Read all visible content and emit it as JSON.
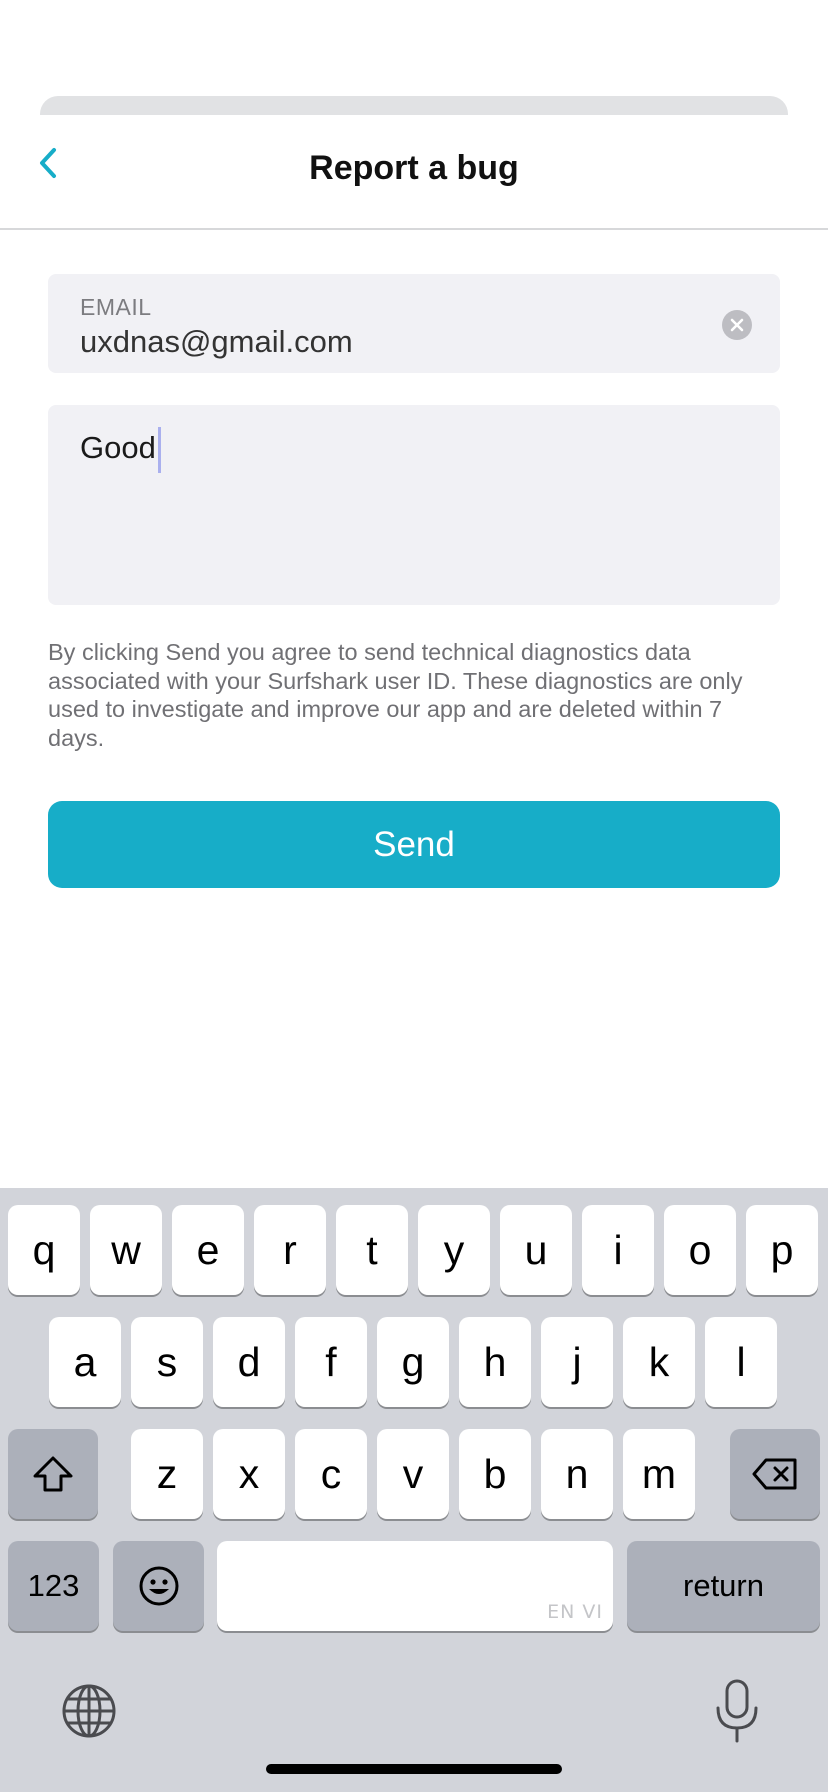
{
  "header": {
    "title": "Report a bug"
  },
  "form": {
    "email_label": "EMAIL",
    "email_value": "uxdnas@gmail.com",
    "message_value": "Good",
    "disclaimer": "By clicking Send you agree to send technical diagnostics data associated with your Surfshark user ID. These diagnostics are only used to investigate and improve our app and are deleted within 7 days.",
    "send_label": "Send"
  },
  "colors": {
    "accent": "#17adc8",
    "field_background": "#f1f1f5",
    "keyboard_background": "#d2d4da"
  },
  "keyboard": {
    "row1": [
      "q",
      "w",
      "e",
      "r",
      "t",
      "y",
      "u",
      "i",
      "o",
      "p"
    ],
    "row2": [
      "a",
      "s",
      "d",
      "f",
      "g",
      "h",
      "j",
      "k",
      "l"
    ],
    "row3": [
      "z",
      "x",
      "c",
      "v",
      "b",
      "n",
      "m"
    ],
    "numbers_label": "123",
    "space_hint": "EN VI",
    "return_label": "return",
    "icons": {
      "shift": "shift-icon",
      "delete": "delete-icon",
      "emoji": "emoji-icon",
      "globe": "globe-icon",
      "mic": "microphone-icon",
      "back": "chevron-left-icon",
      "clear": "clear-icon"
    }
  }
}
